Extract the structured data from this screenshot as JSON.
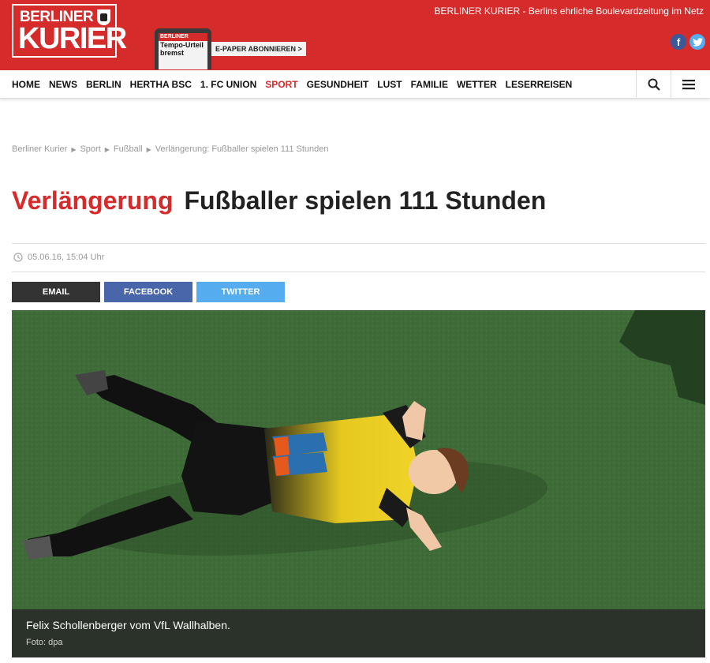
{
  "header": {
    "logo_line1": "BERLINER",
    "logo_line2": "KURIER",
    "tagline_brand": "BERLINER KURIER",
    "tagline_text": " - Berlins ehrliche Boulevardzeitung im Netz",
    "tablet_mast": "BERLINER KURIER",
    "tablet_headline1": "Tempo-Urteil",
    "tablet_headline2": "bremst",
    "epaper_label": "E-PAPER ABONNIEREN >",
    "social": {
      "facebook_glyph": "f",
      "twitter_glyph": "t"
    }
  },
  "nav": {
    "items": [
      {
        "label": "HOME",
        "active": false
      },
      {
        "label": "NEWS",
        "active": false
      },
      {
        "label": "BERLIN",
        "active": false
      },
      {
        "label": "HERTHA BSC",
        "active": false
      },
      {
        "label": "1. FC UNION",
        "active": false
      },
      {
        "label": "SPORT",
        "active": true
      },
      {
        "label": "GESUNDHEIT",
        "active": false
      },
      {
        "label": "LUST",
        "active": false
      },
      {
        "label": "FAMILIE",
        "active": false
      },
      {
        "label": "WETTER",
        "active": false
      },
      {
        "label": "LESERREISEN",
        "active": false
      }
    ]
  },
  "breadcrumb": [
    "Berliner Kurier",
    "Sport",
    "Fußball",
    "Verlängerung: Fußballer spielen 111 Stunden"
  ],
  "article": {
    "kicker": "Verlängerung",
    "headline": "Fußballer spielen 111 Stunden",
    "date": "05.06.16, 15:04 Uhr",
    "caption": "Felix Schollenberger vom VfL Wallhalben.",
    "credit": "Foto: dpa"
  },
  "share": {
    "email": "EMAIL",
    "facebook": "FACEBOOK",
    "twitter": "TWITTER"
  },
  "colors": {
    "brand_red": "#d62b2b",
    "facebook_blue": "#4a66ab",
    "twitter_blue": "#55acee"
  }
}
